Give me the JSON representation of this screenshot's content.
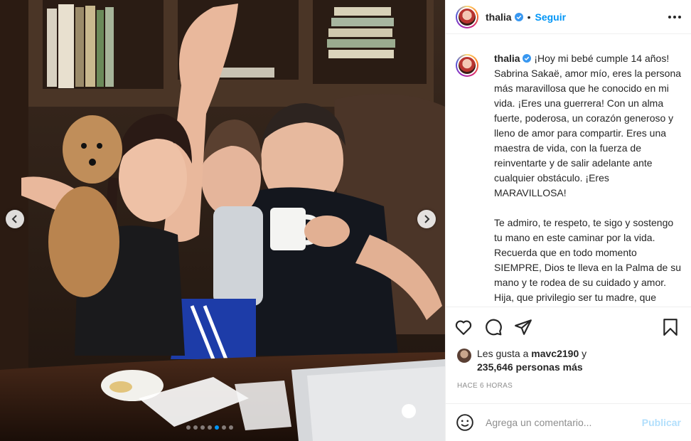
{
  "post": {
    "username": "thalia",
    "follow_label": "Seguir",
    "separator": "•",
    "caption_paragraphs": [
      "¡Hoy mi bebé cumple 14 años! Sabrina Sakaë, amor mío, eres la persona más maravillosa que he conocido en mi vida. ¡Eres una guerrera! Con un alma fuerte, poderosa, un corazón generoso y lleno de amor para compartir. Eres una maestra de vida, con la fuerza de reinventarte y de salir adelante ante cualquier obstáculo. ¡Eres MARAVILLOSA!",
      "Te admiro, te respeto, te sigo y sostengo tu mano en este caminar por la vida. Recuerda que en todo momento SIEMPRE, Dios te lleva en la Palma de su mano y te rodea de su cuidado y amor. Hija, que privilegio ser tu madre, que regalo más hermoso el que me dio mi Señor al darme la vida y ser parte de la tuya."
    ],
    "likes_prefix": "Les gusta a",
    "likes_user": "mavc2190",
    "likes_conjunction": "y",
    "likes_count": "235,646 personas más",
    "time_ago": "HACE 6 HORAS",
    "comment_placeholder": "Agrega un comentario...",
    "publish_label": "Publicar"
  },
  "carousel": {
    "total_slides": 7,
    "active_slide": 5
  },
  "icons": {
    "verified": "verified-badge-icon",
    "more": "more-options-icon",
    "like": "heart-icon",
    "comment": "comment-icon",
    "share": "share-icon",
    "save": "bookmark-icon",
    "emoji": "emoji-icon",
    "prev": "chevron-left-icon",
    "next": "chevron-right-icon"
  },
  "colors": {
    "accent": "#0095f6",
    "publish_disabled": "#b2dffc",
    "muted": "#8e8e8e",
    "text": "#262626"
  }
}
